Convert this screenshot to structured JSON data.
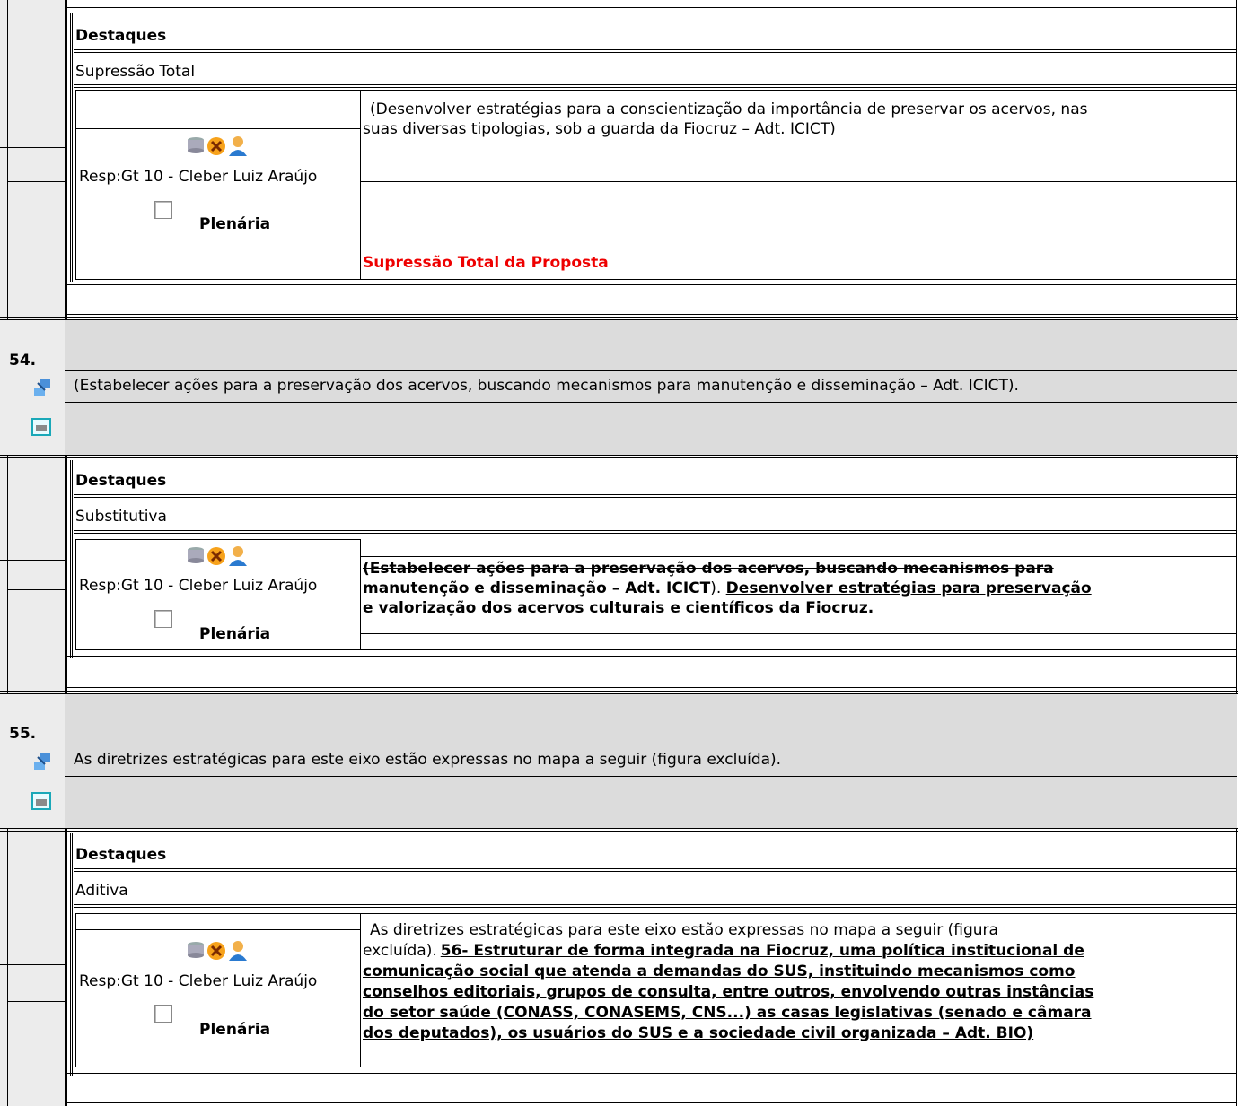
{
  "blocks": [
    {
      "destaques_label": "Destaques",
      "type_label": "Supressão Total",
      "resp": "Resp:Gt 10 - Cleber Luiz Araújo",
      "plenaria": "Plenária",
      "text_plain": "(Desenvolver estratégias para a conscientização da importância de preservar os acervos, nas",
      "text_plain_2": "suas diversas tipologias, sob a guarda da Fiocruz – Adt. ICICT)",
      "red_text": "Supressão Total da Proposta"
    },
    {
      "number": "54.",
      "proposal": "(Estabelecer ações para a preservação dos acervos, buscando mecanismos para manutenção e disseminação – Adt. ICICT).",
      "destaques_label": "Destaques",
      "type_label": "Substitutiva",
      "resp": "Resp:Gt 10 - Cleber Luiz Araújo",
      "plenaria": "Plenária",
      "strike_1": "(Estabelecer ações para a preservação dos acervos, buscando mecanismos para",
      "strike_2": "manutenção e disseminação – Adt. ICICT",
      "close_paren": ").",
      "under_1": "Desenvolver estratégias para preservação",
      "under_2": "e valorização dos acervos culturais e científicos da Fiocruz."
    },
    {
      "number": "55.",
      "proposal": "As diretrizes estratégicas para este eixo estão expressas no mapa a seguir (figura excluída).",
      "destaques_label": "Destaques",
      "type_label": "Aditiva",
      "resp": "Resp:Gt 10 - Cleber Luiz Araújo",
      "plenaria": "Plenária",
      "plain_1": "As diretrizes estratégicas para este eixo estão expressas no mapa a seguir (figura",
      "plain_2": "excluída).",
      "under_1": "56- Estruturar de forma integrada na Fiocruz, uma política institucional de",
      "under_2": "comunicação social que atenda a demandas do SUS, instituindo mecanismos como",
      "under_3": "conselhos editoriais, grupos de consulta, entre outros, envolvendo outras instâncias",
      "under_4": "do setor saúde (CONASS, CONASEMS, CNS...) as casas legislativas (senado e câmara",
      "under_5": "dos deputados), os usuários do SUS e a sociedade civil organizada – Adt. BIO)"
    }
  ],
  "icons": {
    "stack": "database-icon",
    "delete": "delete-x-icon",
    "user": "user-icon",
    "link": "link-icon",
    "print": "print-icon"
  }
}
